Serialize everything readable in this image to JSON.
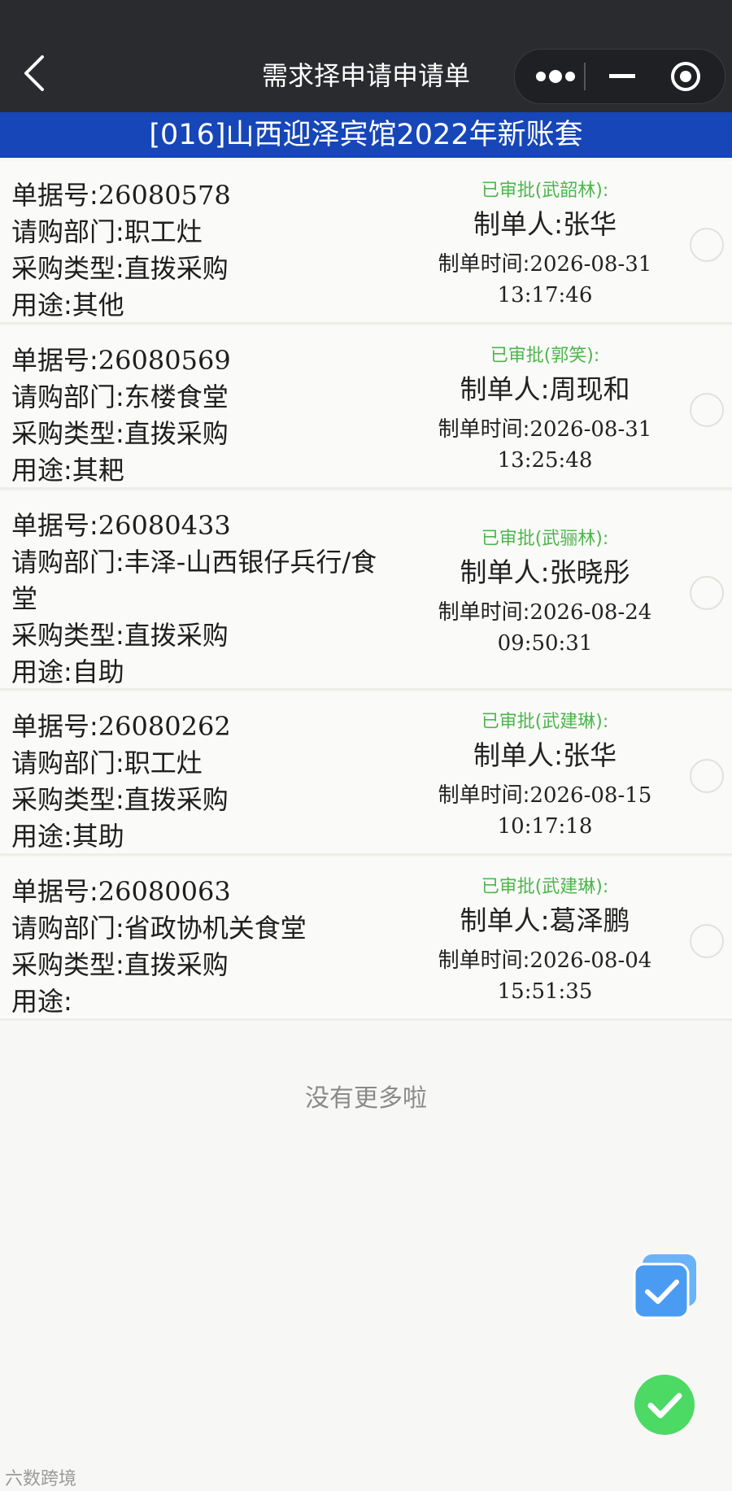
{
  "nav": {
    "title": "需求择申请申请单"
  },
  "banner": {
    "text": "[016]山西迎泽宾馆2022年新账套"
  },
  "labels": {
    "doc_no": "单据号:",
    "dept": "请购部门:",
    "type": "采购类型:",
    "use": "用途:",
    "maker": "制单人:",
    "time": "制单时间:"
  },
  "rows": [
    {
      "doc_no": "26080578",
      "dept": "职工灶",
      "type": "直拨采购",
      "use": "其他",
      "status": "已审批(武韶林):",
      "maker": "张华",
      "date": "2026-08-31",
      "clock": "13:17:46"
    },
    {
      "doc_no": "26080569",
      "dept": "东楼食堂",
      "type": "直拨采购",
      "use": "其耙",
      "status": "已审批(郭笑):",
      "maker": "周现和",
      "date": "2026-08-31",
      "clock": "13:25:48"
    },
    {
      "doc_no": "26080433",
      "dept": "丰泽-山西银仔兵行/食堂",
      "type": "直拨采购",
      "use": "自助",
      "status": "已审批(武骊林):",
      "maker": "张晓彤",
      "date": "2026-08-24",
      "clock": "09:50:31"
    },
    {
      "doc_no": "26080262",
      "dept": "职工灶",
      "type": "直拨采购",
      "use": "其助",
      "status": "已审批(武建琳):",
      "maker": "张华",
      "date": "2026-08-15",
      "clock": "10:17:18"
    },
    {
      "doc_no": "26080063",
      "dept": "省政协机关食堂",
      "type": "直拨采购",
      "use": "",
      "status": "已审批(武建琳):",
      "maker": "葛泽鹏",
      "date": "2026-08-04",
      "clock": "15:51:35"
    }
  ],
  "footer": {
    "no_more": "没有更多啦"
  },
  "watermark": {
    "text": "六数跨境"
  },
  "colors": {
    "banner": "#1646b8",
    "status": "#4db54d",
    "fab_blue": "#4a9cf2",
    "fab_green": "#4cd964"
  },
  "icons": [
    "back-arrow-icon",
    "more-dots-icon",
    "minimize-icon",
    "close-circle-icon",
    "multi-check-icon",
    "check-icon"
  ]
}
